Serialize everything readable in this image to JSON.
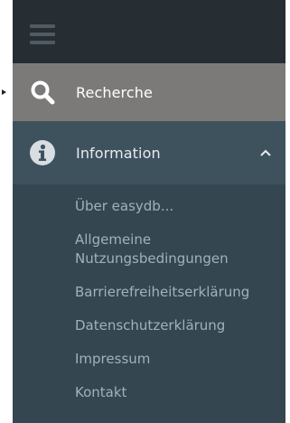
{
  "nav": {
    "menu_icon": "hamburger-menu-icon",
    "items": [
      {
        "label": "Recherche",
        "icon": "search-icon",
        "active": true
      },
      {
        "label": "Information",
        "icon": "info-icon",
        "expanded": true
      }
    ],
    "submenu": [
      {
        "label": "Über easydb..."
      },
      {
        "label": "Allgemeine Nutzungsbedingungen"
      },
      {
        "label": "Barrierefreiheitserklärung"
      },
      {
        "label": "Datenschutzerklärung"
      },
      {
        "label": "Impressum"
      },
      {
        "label": "Kontakt"
      }
    ]
  },
  "colors": {
    "topbar": "#262d33",
    "sidebar": "#344650",
    "active_item": "#7c7a79",
    "section_item": "#3e525e",
    "sub_text": "#9eb3bf"
  }
}
